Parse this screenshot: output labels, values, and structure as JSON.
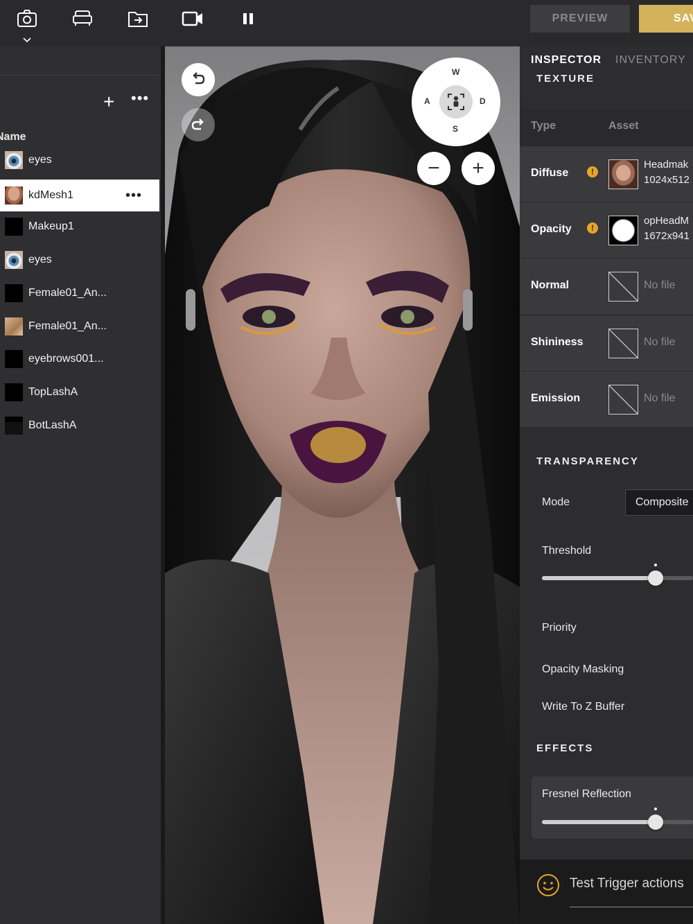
{
  "toolbar": {
    "icons": [
      "camera-icon",
      "furniture-icon",
      "export-folder-icon",
      "video-camera-icon",
      "pause-icon"
    ],
    "preview_label": "PREVIEW",
    "save_label": "SAVE"
  },
  "layers_panel": {
    "column_header": "Name",
    "items": [
      {
        "name": "eyes",
        "thumb": "eye"
      },
      {
        "name": "kdMesh1",
        "thumb": "face",
        "selected": true
      },
      {
        "name": "Makeup1",
        "thumb": "black"
      },
      {
        "name": "eyes",
        "thumb": "eye"
      },
      {
        "name": "Female01_An...",
        "thumb": "black"
      },
      {
        "name": "Female01_An...",
        "thumb": "skin"
      },
      {
        "name": "eyebrows001...",
        "thumb": "black"
      },
      {
        "name": "TopLashA",
        "thumb": "black"
      },
      {
        "name": "BotLashA",
        "thumb": "lash"
      }
    ]
  },
  "viewport": {
    "nav_labels": {
      "up": "W",
      "left": "A",
      "right": "D",
      "down": "S"
    },
    "zoom_out": "−",
    "zoom_in": "+"
  },
  "inspector": {
    "tabs": {
      "active": "INSPECTOR",
      "inactive": "INVENTORY"
    },
    "texture_section": "TEXTURE",
    "columns": {
      "type": "Type",
      "asset": "Asset"
    },
    "textures": [
      {
        "type": "Diffuse",
        "warning": true,
        "line1": "Headmak",
        "line2": "1024x512"
      },
      {
        "type": "Opacity",
        "warning": true,
        "line1": "opHeadM",
        "line2": "1672x941"
      },
      {
        "type": "Normal",
        "warning": false,
        "file": "No file"
      },
      {
        "type": "Shininess",
        "warning": false,
        "file": "No file"
      },
      {
        "type": "Emission",
        "warning": false,
        "file": "No file"
      }
    ],
    "transparency_section": "TRANSPARENCY",
    "mode_label": "Mode",
    "mode_value": "Composite",
    "threshold_label": "Threshold",
    "threshold_value": 0.75,
    "priority_label": "Priority",
    "opacity_masking_label": "Opacity Masking",
    "write_z_label": "Write To Z Buffer",
    "effects_section": "EFFECTS",
    "fresnel_label": "Fresnel Reflection",
    "fresnel_value": 0.75
  },
  "chat": {
    "placeholder": "Test Trigger actions"
  },
  "colors": {
    "accent": "#d4b25c",
    "warning": "#e9a427",
    "panel": "#2d2d2f",
    "selected_row": "#ffffff"
  }
}
